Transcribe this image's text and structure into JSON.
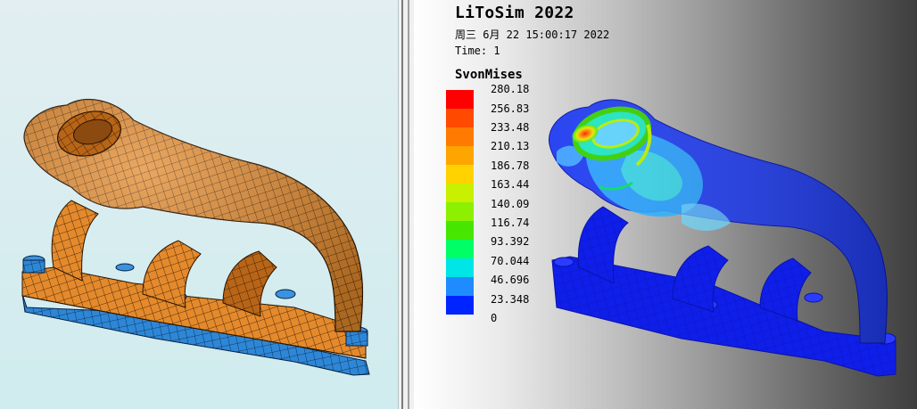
{
  "viewport_left": {
    "name": "mesh-view",
    "background": "#d8edf0",
    "part_color": "#e0892e",
    "base_color": "#2f8ad8"
  },
  "viewport_right": {
    "app_title": "LiToSim 2022",
    "datetime": "周三 6月 22 15:00:17 2022",
    "time_label": "Time: 1",
    "legend_title": "SvonMises",
    "legend": {
      "values": [
        "280.18",
        "256.83",
        "233.48",
        "210.13",
        "186.78",
        "163.44",
        "140.09",
        "116.74",
        "93.392",
        "70.044",
        "46.696",
        "23.348",
        "0"
      ],
      "colors": [
        "#ff0000",
        "#ff4a00",
        "#ff7a00",
        "#ffa500",
        "#ffd200",
        "#c8f000",
        "#8cf000",
        "#46e600",
        "#00ff64",
        "#00e6e6",
        "#1e8cff",
        "#0024ff"
      ]
    }
  }
}
